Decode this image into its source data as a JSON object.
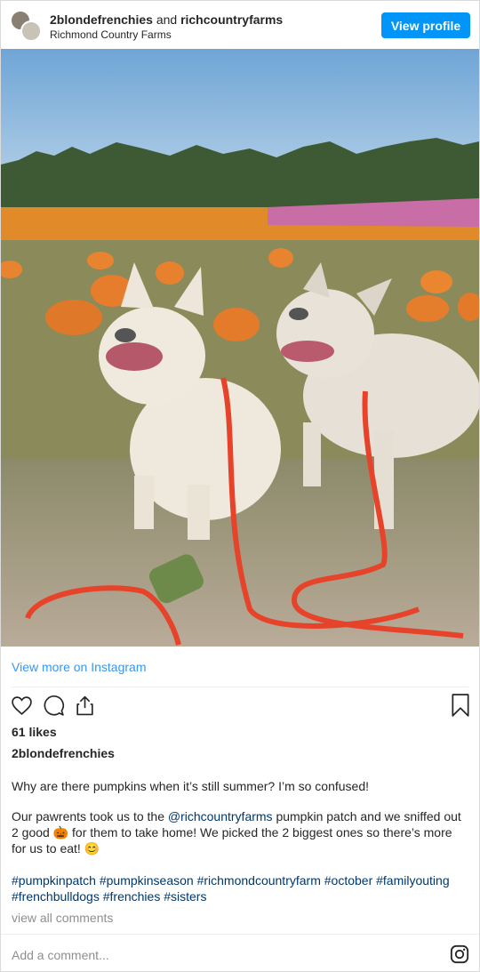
{
  "header": {
    "account_primary": "2blondefrenchies",
    "joiner": "and",
    "account_secondary": "richcountryfarms",
    "location": "Richmond Country Farms",
    "view_profile_label": "View profile"
  },
  "photo": {
    "description_icon": "two-french-bulldogs-in-pumpkin-patch-photo"
  },
  "post": {
    "view_more_label": "View more on Instagram",
    "likes_text": "61 likes",
    "author": "2blondefrenchies",
    "caption_line1": "Why are there pumpkins when it’s still summer? I’m so confused!",
    "caption_p2_a": "Our pawrents took us to the ",
    "caption_mention": "@richcountryfarms",
    "caption_p2_b": " pumpkin patch and we sniffed out 2 good ",
    "caption_emoji_pumpkin": "🎃",
    "caption_p2_c": " for them to take home! We picked the 2 biggest ones so there’s more for us to eat! ",
    "caption_emoji_smile": "😊",
    "hashtags": "#pumpkinpatch #pumpkinseason #richmondcountryfarm #october #familyouting #frenchbulldogs #frenchies #sisters",
    "view_all_comments": "view all comments",
    "add_comment_placeholder": "Add a comment..."
  },
  "colors": {
    "accent": "#0095f6",
    "link": "#00376b",
    "muted": "#8e8e8e"
  }
}
